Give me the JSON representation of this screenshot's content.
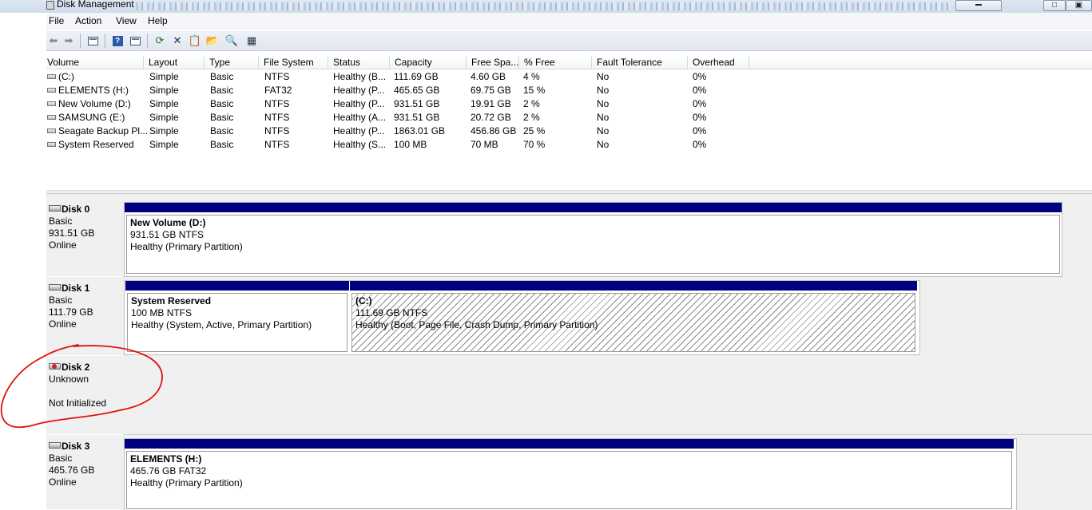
{
  "window": {
    "title": "Disk Management"
  },
  "menu": [
    "File",
    "Action",
    "View",
    "Help"
  ],
  "toolbar": [
    "back-arrow-icon",
    "forward-arrow-icon",
    "console-tree-icon",
    "help-icon",
    "properties-view-icon",
    "refresh-icon",
    "delete-icon",
    "properties-icon",
    "open-icon",
    "find-icon",
    "settings-icon"
  ],
  "volume_list": {
    "columns": [
      "Volume",
      "Layout",
      "Type",
      "File System",
      "Status",
      "Capacity",
      "Free Spa...",
      "% Free",
      "Fault Tolerance",
      "Overhead"
    ],
    "rows": [
      [
        "(C:)",
        "Simple",
        "Basic",
        "NTFS",
        "Healthy (B...",
        "111.69 GB",
        "4.60 GB",
        "4 %",
        "No",
        "0%"
      ],
      [
        "ELEMENTS (H:)",
        "Simple",
        "Basic",
        "FAT32",
        "Healthy (P...",
        "465.65 GB",
        "69.75 GB",
        "15 %",
        "No",
        "0%"
      ],
      [
        "New Volume (D:)",
        "Simple",
        "Basic",
        "NTFS",
        "Healthy (P...",
        "931.51 GB",
        "19.91 GB",
        "2 %",
        "No",
        "0%"
      ],
      [
        "SAMSUNG (E:)",
        "Simple",
        "Basic",
        "NTFS",
        "Healthy (A...",
        "931.51 GB",
        "20.72 GB",
        "2 %",
        "No",
        "0%"
      ],
      [
        "Seagate Backup Pl...",
        "Simple",
        "Basic",
        "NTFS",
        "Healthy (P...",
        "1863.01 GB",
        "456.86 GB",
        "25 %",
        "No",
        "0%"
      ],
      [
        "System Reserved",
        "Simple",
        "Basic",
        "NTFS",
        "Healthy (S...",
        "100 MB",
        "70 MB",
        "70 %",
        "No",
        "0%"
      ]
    ]
  },
  "disks": [
    {
      "name": "Disk 0",
      "type": "Basic",
      "size": "931.51 GB",
      "state": "Online",
      "partitions": [
        {
          "name": "New Volume  (D:)",
          "size": "931.51 GB NTFS",
          "status": "Healthy (Primary Partition)"
        }
      ]
    },
    {
      "name": "Disk 1",
      "type": "Basic",
      "size": "111.79 GB",
      "state": "Online",
      "partitions": [
        {
          "name": "System Reserved",
          "size": "100 MB NTFS",
          "status": "Healthy (System, Active, Primary Partition)"
        },
        {
          "name": "(C:)",
          "size": "111.69 GB NTFS",
          "status": "Healthy (Boot, Page File, Crash Dump, Primary Partition)"
        }
      ]
    },
    {
      "name": "Disk 2",
      "type": "Unknown",
      "size": "",
      "state": "Not Initialized",
      "partitions": []
    },
    {
      "name": "Disk 3",
      "type": "Basic",
      "size": "465.76 GB",
      "state": "Online",
      "partitions": [
        {
          "name": "ELEMENTS  (H:)",
          "size": "465.76 GB FAT32",
          "status": "Healthy (Primary Partition)"
        }
      ]
    }
  ],
  "colors": {
    "primary_partition_bar": "#000080",
    "annotation": "#e01010"
  }
}
